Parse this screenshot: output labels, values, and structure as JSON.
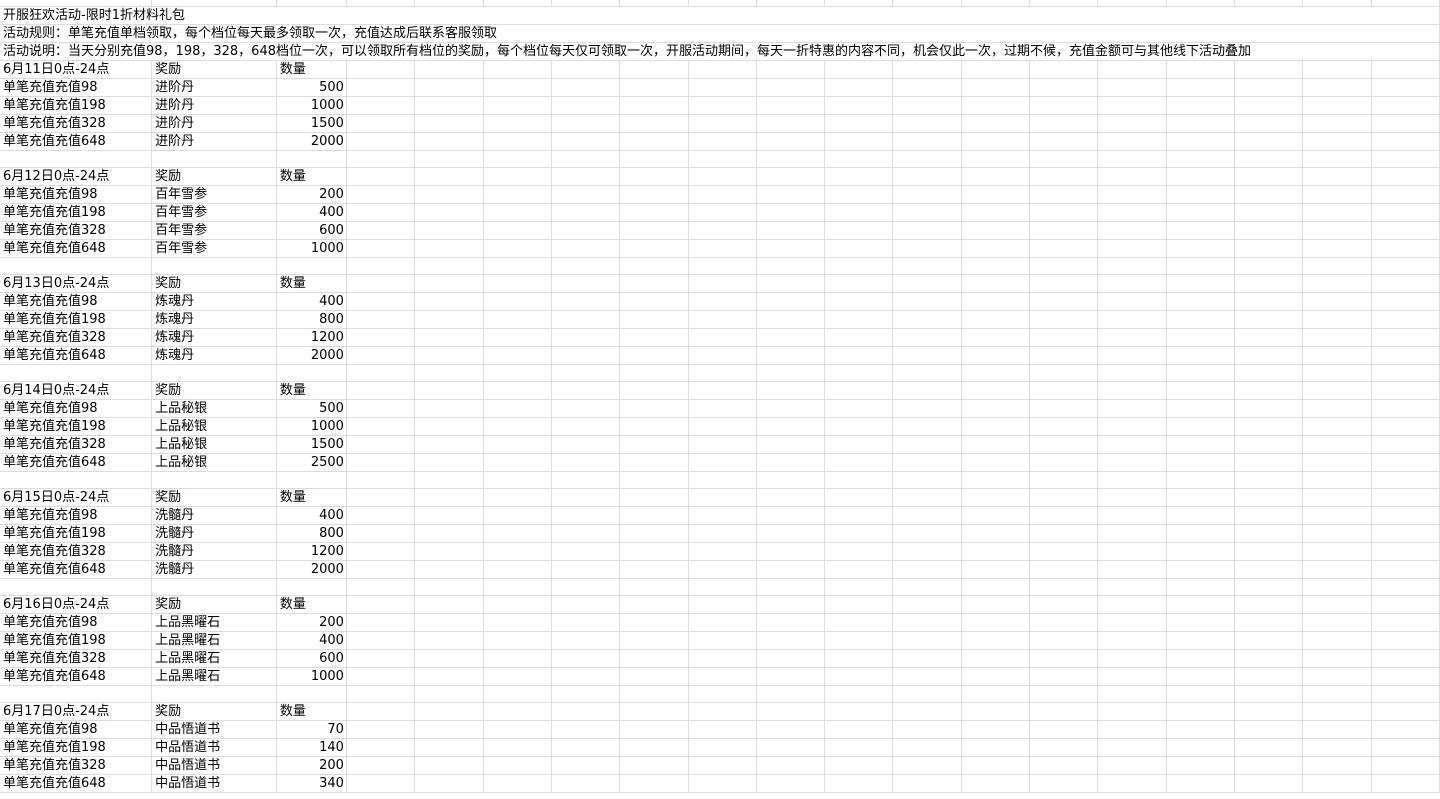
{
  "sheet": {
    "title": "开服狂欢活动-限时1折材料礼包",
    "rules": "活动规则：单笔充值单档领取，每个档位每天最多领取一次，充值达成后联系客服领取",
    "description": "活动说明：当天分别充值98，198，328，648档位一次，可以领取所有档位的奖励，每个档位每天仅可领取一次，开服活动期间，每天一折特惠的内容不同，机会仅此一次，过期不候，充值金额可与其他线下活动叠加",
    "header_reward": "奖励",
    "header_qty": "数量",
    "tiers": [
      "单笔充值充值98",
      "单笔充值充值198",
      "单笔充值充值328",
      "单笔充值充值648"
    ],
    "days": [
      {
        "date": "6月11日0点-24点",
        "item": "进阶丹",
        "qty": [
          500,
          1000,
          1500,
          2000
        ]
      },
      {
        "date": "6月12日0点-24点",
        "item": "百年雪参",
        "qty": [
          200,
          400,
          600,
          1000
        ]
      },
      {
        "date": "6月13日0点-24点",
        "item": "炼魂丹",
        "qty": [
          400,
          800,
          1200,
          2000
        ]
      },
      {
        "date": "6月14日0点-24点",
        "item": "上品秘银",
        "qty": [
          500,
          1000,
          1500,
          2500
        ]
      },
      {
        "date": "6月15日0点-24点",
        "item": "洗髓丹",
        "qty": [
          400,
          800,
          1200,
          2000
        ]
      },
      {
        "date": "6月16日0点-24点",
        "item": "上品黑曜石",
        "qty": [
          200,
          400,
          600,
          1000
        ]
      },
      {
        "date": "6月17日0点-24点",
        "item": "中品悟道书",
        "qty": [
          70,
          140,
          200,
          340
        ]
      }
    ]
  }
}
